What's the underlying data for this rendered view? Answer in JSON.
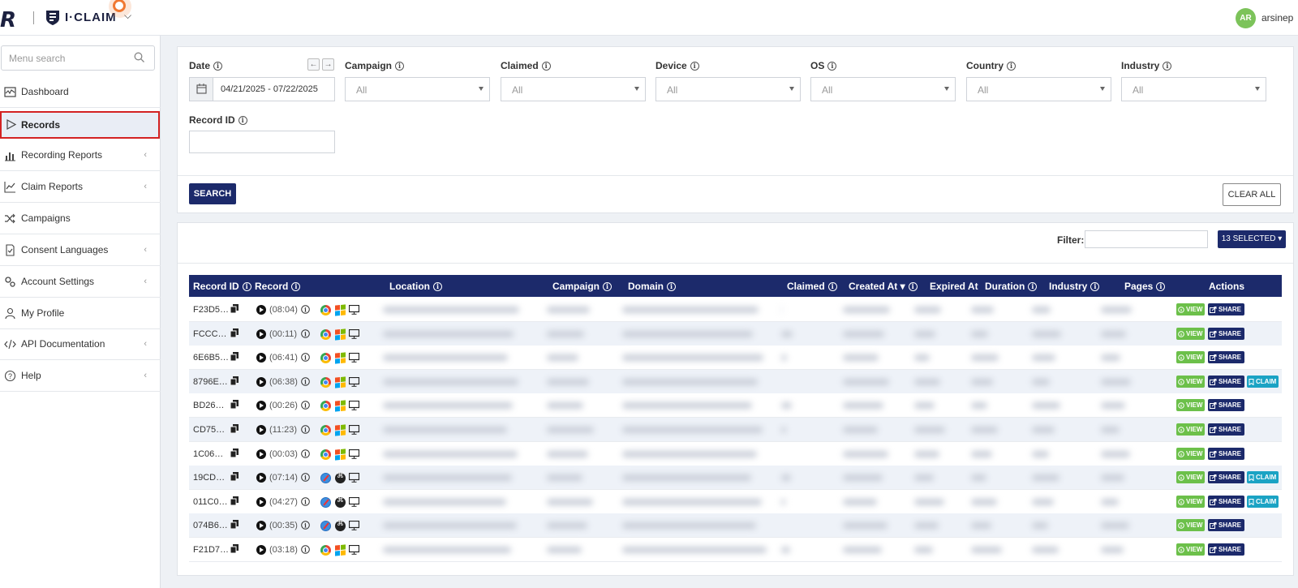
{
  "header": {
    "logo_text": "I·CLAIM",
    "user_initials": "AR",
    "username": "arsinep"
  },
  "sidebar": {
    "search_placeholder": "Menu search",
    "items": [
      {
        "label": "Dashboard",
        "icon": "dashboard-icon",
        "expandable": false
      },
      {
        "label": "Records",
        "icon": "play-outline-icon",
        "expandable": false,
        "active": true
      },
      {
        "label": "Recording Reports",
        "icon": "bar-chart-icon",
        "expandable": true
      },
      {
        "label": "Claim Reports",
        "icon": "line-chart-icon",
        "expandable": true
      },
      {
        "label": "Campaigns",
        "icon": "shuffle-icon",
        "expandable": false
      },
      {
        "label": "Consent Languages",
        "icon": "document-check-icon",
        "expandable": true
      },
      {
        "label": "Account Settings",
        "icon": "gears-icon",
        "expandable": true
      },
      {
        "label": "My Profile",
        "icon": "user-icon",
        "expandable": false
      },
      {
        "label": "API Documentation",
        "icon": "code-icon",
        "expandable": true
      },
      {
        "label": "Help",
        "icon": "question-circle-icon",
        "expandable": true
      }
    ]
  },
  "filters": {
    "date_label": "Date",
    "date_value": "04/21/2025 - 07/22/2025",
    "campaign_label": "Campaign",
    "campaign_value": "All",
    "claimed_label": "Claimed",
    "claimed_value": "All",
    "device_label": "Device",
    "device_value": "All",
    "os_label": "OS",
    "os_value": "All",
    "country_label": "Country",
    "country_value": "All",
    "industry_label": "Industry",
    "industry_value": "All",
    "record_id_label": "Record ID",
    "record_id_value": "",
    "search_button": "SEARCH",
    "clear_button": "CLEAR ALL"
  },
  "records": {
    "filter_label": "Filter:",
    "filter_value": "",
    "selected_button": "13 SELECTED",
    "columns": [
      "Record ID",
      "Record",
      "Location",
      "Campaign",
      "Domain",
      "Claimed",
      "Created At",
      "Expired At",
      "Duration",
      "Industry",
      "Pages",
      "Actions"
    ],
    "view_label": "VIEW",
    "share_label": "SHARE",
    "claim_label": "CLAIM",
    "rows": [
      {
        "id": "F23D5…",
        "duration": "(08:04)",
        "browser": "chrome",
        "os": "windows",
        "claim": false
      },
      {
        "id": "FCCC…",
        "duration": "(00:11)",
        "browser": "chrome",
        "os": "windows",
        "claim": false
      },
      {
        "id": "6E6B5…",
        "duration": "(06:41)",
        "browser": "chrome",
        "os": "windows",
        "claim": false
      },
      {
        "id": "8796E…",
        "duration": "(06:38)",
        "browser": "chrome",
        "os": "windows",
        "claim": true
      },
      {
        "id": "BD26…",
        "duration": "(00:26)",
        "browser": "chrome",
        "os": "windows",
        "claim": false
      },
      {
        "id": "CD75…",
        "duration": "(11:23)",
        "browser": "chrome",
        "os": "windows",
        "claim": false
      },
      {
        "id": "1C06…",
        "duration": "(00:03)",
        "browser": "chrome",
        "os": "windows",
        "claim": false
      },
      {
        "id": "19CD…",
        "duration": "(07:14)",
        "browser": "safari",
        "os": "macos",
        "claim": true
      },
      {
        "id": "011C0…",
        "duration": "(04:27)",
        "browser": "safari",
        "os": "macos",
        "claim": true
      },
      {
        "id": "074B6…",
        "duration": "(00:35)",
        "browser": "safari",
        "os": "macos",
        "claim": false
      },
      {
        "id": "F21D7…",
        "duration": "(03:18)",
        "browser": "chrome",
        "os": "windows",
        "claim": false
      }
    ]
  },
  "colors": {
    "navy": "#1c2a6b",
    "view_green": "#6cc04a",
    "claim_teal": "#1ba3c4",
    "active_border": "#d32222",
    "avatar_green": "#7cc35a"
  }
}
